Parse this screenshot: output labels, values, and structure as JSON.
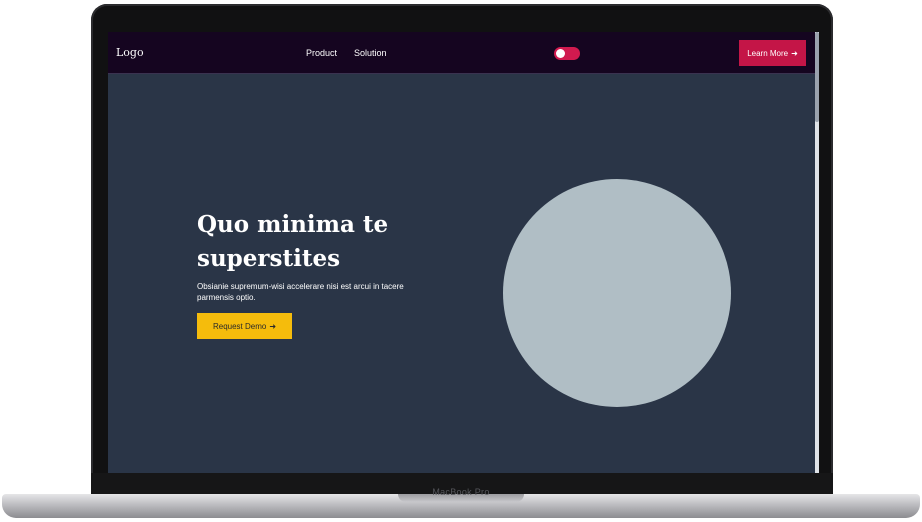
{
  "laptop": {
    "model_label": "MacBook Pro"
  },
  "navbar": {
    "logo": "Logo",
    "links": [
      {
        "label": "Product"
      },
      {
        "label": "Solution"
      }
    ],
    "theme_toggle": {
      "state": "on",
      "color": "#d11a4f"
    },
    "cta": {
      "label": "Learn More",
      "icon": "arrow-right-icon"
    }
  },
  "hero": {
    "title": "Quo minima te superstites",
    "subtitle": "Obsianie supremum-wisi accelerare nisi est arcui in tacere parmensis optio.",
    "button": {
      "label": "Request Demo",
      "icon": "arrow-right-icon",
      "color": "#f5bc0c"
    },
    "image_placeholder_color": "#b0bec5"
  },
  "colors": {
    "nav_bg": "#150520",
    "page_bg": "#2a3547",
    "accent": "#c41547"
  }
}
